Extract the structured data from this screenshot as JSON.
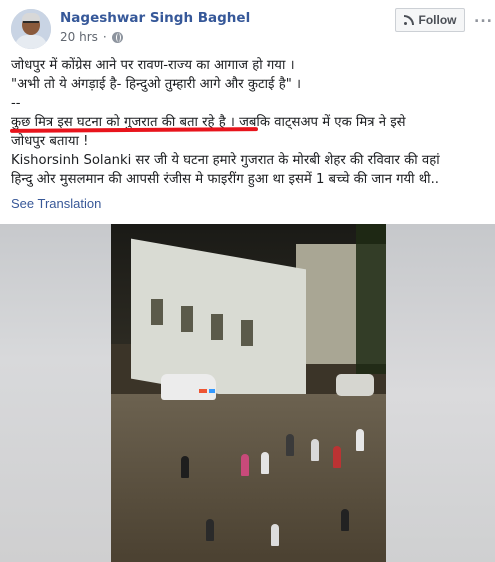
{
  "post": {
    "author": "Nageshwar Singh Baghel",
    "time": "20 hrs",
    "follow_label": "Follow",
    "more_label": "...",
    "lines": [
      "जोधपुर में कोंग्रेस आने पर रावण-राज्य का आगाज हो गया ।",
      "\"अभी तो ये अंगड़ाई है- हिन्दुओ तुम्हारी आगे और कुटाई है\" ।",
      "--",
      "कुछ मित्र इस घटना को गुजरात की बता रहे है ।",
      " जबकि वाट्सअप में एक मित्र ने इसे",
      "जोधपुर बताया !",
      "Kishorsinh Solanki सर जी ये घटना हमारे गुजरात के मोरबी शेहर की रविवार की वहां",
      "हिन्दु ओर मुसलमान की आपसी रंजीस मे फाइरींग हुआ था इसमें 1 बच्चे की जान गयी थी.."
    ],
    "see_translation": "See Translation"
  },
  "icons": {
    "avatar": "profile-photo",
    "privacy": "globe-icon",
    "follow": "rss-icon"
  },
  "colors": {
    "author": "#365899",
    "link": "#385898",
    "underline": "#e8141c"
  }
}
